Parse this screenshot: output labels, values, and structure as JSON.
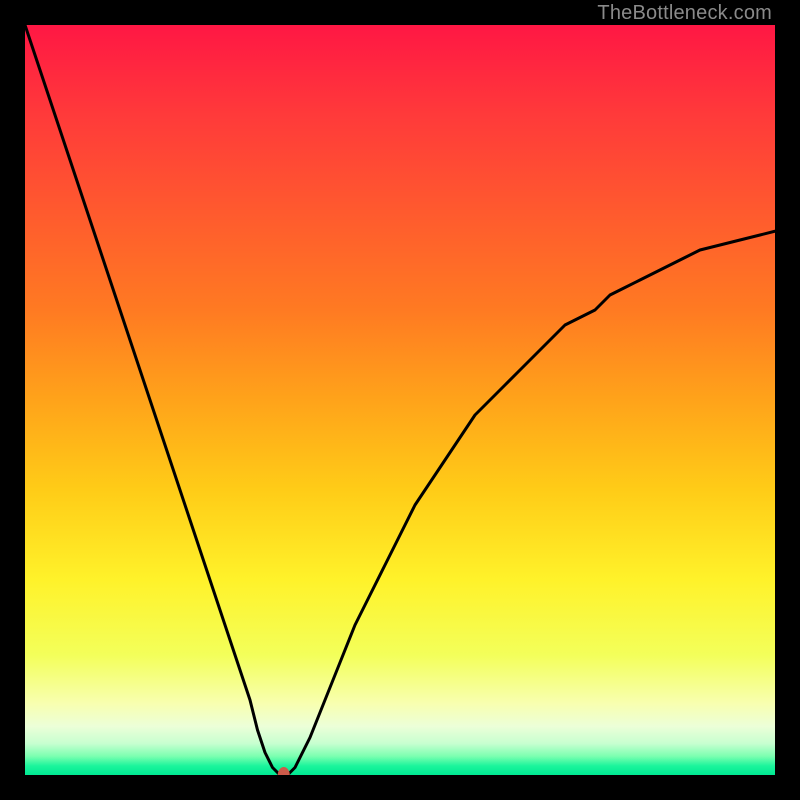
{
  "watermark": "TheBottleneck.com",
  "chart_data": {
    "type": "line",
    "title": "",
    "xlabel": "",
    "ylabel": "",
    "xlim": [
      0,
      100
    ],
    "ylim": [
      0,
      100
    ],
    "grid": false,
    "legend": false,
    "annotations": [],
    "series": [
      {
        "name": "bottleneck-curve",
        "x": [
          0,
          2,
          4,
          6,
          8,
          10,
          12,
          14,
          16,
          18,
          20,
          22,
          24,
          26,
          28,
          30,
          31,
          32,
          33,
          34,
          35,
          36,
          38,
          40,
          42,
          44,
          46,
          48,
          50,
          52,
          54,
          56,
          58,
          60,
          62,
          64,
          66,
          68,
          70,
          72,
          74,
          76,
          78,
          80,
          82,
          84,
          86,
          88,
          90,
          92,
          94,
          96,
          98,
          100
        ],
        "y": [
          100,
          94,
          88,
          82,
          76,
          70,
          64,
          58,
          52,
          46,
          40,
          34,
          28,
          22,
          16,
          10,
          6,
          3,
          1,
          0,
          0,
          1,
          5,
          10,
          15,
          20,
          24,
          28,
          32,
          36,
          39,
          42,
          45,
          48,
          50,
          52,
          54,
          56,
          58,
          60,
          61,
          62,
          64,
          65,
          66,
          67,
          68,
          69,
          70,
          70.5,
          71,
          71.5,
          72,
          72.5
        ]
      }
    ],
    "marker": {
      "x": 34.5,
      "y": 0,
      "color": "#cc5b4a",
      "rx": 6,
      "ry": 8
    },
    "background_gradient": {
      "type": "vertical",
      "stops": [
        {
          "offset": 0.0,
          "color": "#ff1744"
        },
        {
          "offset": 0.12,
          "color": "#ff3a3a"
        },
        {
          "offset": 0.25,
          "color": "#ff5a2e"
        },
        {
          "offset": 0.38,
          "color": "#ff7a22"
        },
        {
          "offset": 0.5,
          "color": "#ffa31a"
        },
        {
          "offset": 0.62,
          "color": "#ffcc17"
        },
        {
          "offset": 0.74,
          "color": "#fff22a"
        },
        {
          "offset": 0.84,
          "color": "#f3ff5a"
        },
        {
          "offset": 0.905,
          "color": "#f8ffb0"
        },
        {
          "offset": 0.935,
          "color": "#ecffd8"
        },
        {
          "offset": 0.958,
          "color": "#c7ffd0"
        },
        {
          "offset": 0.975,
          "color": "#7bffb0"
        },
        {
          "offset": 0.988,
          "color": "#1af59c"
        },
        {
          "offset": 1.0,
          "color": "#00e893"
        }
      ]
    }
  }
}
